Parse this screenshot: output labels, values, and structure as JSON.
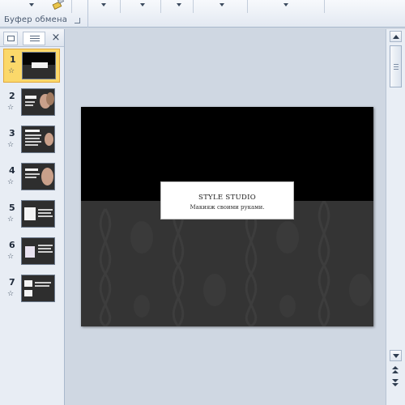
{
  "ribbon": {
    "group_label": "Буфер обмена",
    "dropdowns": [
      "chevron-down",
      "chevron-down",
      "chevron-down",
      "chevron-down",
      "chevron-down",
      "chevron-down"
    ]
  },
  "slides_panel": {
    "close_symbol": "×",
    "star_symbol": "☆",
    "slides": [
      {
        "number": "1",
        "selected": true
      },
      {
        "number": "2",
        "selected": false
      },
      {
        "number": "3",
        "selected": false
      },
      {
        "number": "4",
        "selected": false
      },
      {
        "number": "5",
        "selected": false
      },
      {
        "number": "6",
        "selected": false
      },
      {
        "number": "7",
        "selected": false
      }
    ]
  },
  "slide": {
    "title": "STYLE STUDIO",
    "subtitle": "Макияж своими руками.",
    "top_color": "#000000",
    "bottom_color": "#343434"
  },
  "colors": {
    "selection": "#fbd86a",
    "selection_border": "#e1a83a"
  }
}
